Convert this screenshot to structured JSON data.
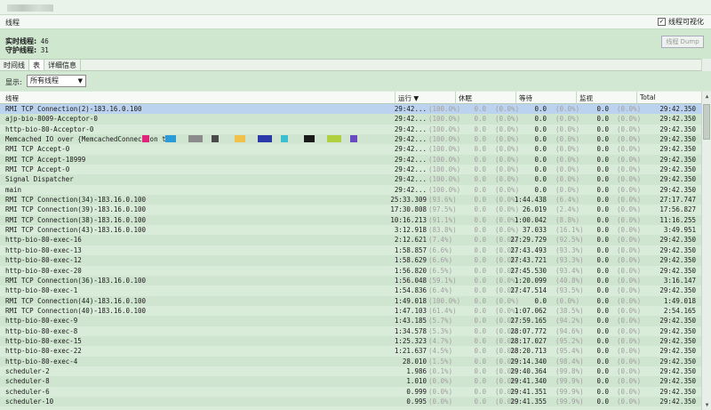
{
  "window": {
    "title": "线程",
    "visualize_label": "线程可视化",
    "visualize_checked": "✓"
  },
  "summary": {
    "live_label": "实时线程:",
    "live_value": "46",
    "daemon_label": "守护线程:",
    "daemon_value": "31",
    "dump_label": "线程 Dump"
  },
  "tabs": [
    {
      "label": "时间线"
    },
    {
      "label": "表"
    },
    {
      "label": "详细信息"
    }
  ],
  "filter": {
    "label": "显示:",
    "value": "所有线程"
  },
  "columns": {
    "thread": "线程",
    "running": "运行",
    "sleeping": "休眠",
    "wait": "等待",
    "monitor": "监视",
    "total": "Total"
  },
  "rows": [
    {
      "name": "RMI TCP Connection(2)-183.16.0.100",
      "run": "29:42...",
      "runp": "(100.0%)",
      "sleep": "0.0",
      "sleepp": "(0.0%)",
      "wait": "0.0",
      "waitp": "(0.0%)",
      "mon": "0.0",
      "monp": "(0.0%)",
      "total": "29:42.350"
    },
    {
      "name": "ajp-bio-8009-Acceptor-0",
      "run": "29:42...",
      "runp": "(100.0%)",
      "sleep": "0.0",
      "sleepp": "(0.0%)",
      "wait": "0.0",
      "waitp": "(0.0%)",
      "mon": "0.0",
      "monp": "(0.0%)",
      "total": "29:42.350"
    },
    {
      "name": "http-bio-80-Acceptor-0",
      "run": "29:42...",
      "runp": "(100.0%)",
      "sleep": "0.0",
      "sleepp": "(0.0%)",
      "wait": "0.0",
      "waitp": "(0.0%)",
      "mon": "0.0",
      "monp": "(0.0%)",
      "total": "29:42.350"
    },
    {
      "name": "Memcached IO over {MemcachedConnection to ",
      "run": "29:42...",
      "runp": "(100.0%)",
      "sleep": "0.0",
      "sleepp": "(0.0%)",
      "wait": "0.0",
      "waitp": "(0.0%)",
      "mon": "0.0",
      "monp": "(0.0%)",
      "total": "29:42.350"
    },
    {
      "name": "RMI TCP Accept-0",
      "run": "29:42...",
      "runp": "(100.0%)",
      "sleep": "0.0",
      "sleepp": "(0.0%)",
      "wait": "0.0",
      "waitp": "(0.0%)",
      "mon": "0.0",
      "monp": "(0.0%)",
      "total": "29:42.350"
    },
    {
      "name": "RMI TCP Accept-18999",
      "run": "29:42...",
      "runp": "(100.0%)",
      "sleep": "0.0",
      "sleepp": "(0.0%)",
      "wait": "0.0",
      "waitp": "(0.0%)",
      "mon": "0.0",
      "monp": "(0.0%)",
      "total": "29:42.350"
    },
    {
      "name": "RMI TCP Accept-0",
      "run": "29:42...",
      "runp": "(100.0%)",
      "sleep": "0.0",
      "sleepp": "(0.0%)",
      "wait": "0.0",
      "waitp": "(0.0%)",
      "mon": "0.0",
      "monp": "(0.0%)",
      "total": "29:42.350"
    },
    {
      "name": "Signal Dispatcher",
      "run": "29:42...",
      "runp": "(100.0%)",
      "sleep": "0.0",
      "sleepp": "(0.0%)",
      "wait": "0.0",
      "waitp": "(0.0%)",
      "mon": "0.0",
      "monp": "(0.0%)",
      "total": "29:42.350"
    },
    {
      "name": "main",
      "run": "29:42...",
      "runp": "(100.0%)",
      "sleep": "0.0",
      "sleepp": "(0.0%)",
      "wait": "0.0",
      "waitp": "(0.0%)",
      "mon": "0.0",
      "monp": "(0.0%)",
      "total": "29:42.350"
    },
    {
      "name": "RMI TCP Connection(34)-183.16.0.100",
      "run": "25:33.309",
      "runp": "(93.6%)",
      "sleep": "0.0",
      "sleepp": "(0.0%)",
      "wait": "1:44.438",
      "waitp": "(6.4%)",
      "mon": "0.0",
      "monp": "(0.0%)",
      "total": "27:17.747"
    },
    {
      "name": "RMI TCP Connection(39)-183.16.0.100",
      "run": "17:30.808",
      "runp": "(97.5%)",
      "sleep": "0.0",
      "sleepp": "(0.0%)",
      "wait": "26.019",
      "waitp": "(2.4%)",
      "mon": "0.0",
      "monp": "(0.0%)",
      "total": "17:56.827"
    },
    {
      "name": "RMI TCP Connection(38)-183.16.0.100",
      "run": "10:16.213",
      "runp": "(91.1%)",
      "sleep": "0.0",
      "sleepp": "(0.0%)",
      "wait": "1:00.042",
      "waitp": "(8.8%)",
      "mon": "0.0",
      "monp": "(0.0%)",
      "total": "11:16.255"
    },
    {
      "name": "RMI TCP Connection(43)-183.16.0.100",
      "run": "3:12.918",
      "runp": "(83.8%)",
      "sleep": "0.0",
      "sleepp": "(0.0%)",
      "wait": "37.033",
      "waitp": "(16.1%)",
      "mon": "0.0",
      "monp": "(0.0%)",
      "total": "3:49.951"
    },
    {
      "name": "http-bio-80-exec-16",
      "run": "2:12.621",
      "runp": "(7.4%)",
      "sleep": "0.0",
      "sleepp": "(0.0%)",
      "wait": "27:29.729",
      "waitp": "(92.5%)",
      "mon": "0.0",
      "monp": "(0.0%)",
      "total": "29:42.350"
    },
    {
      "name": "http-bio-80-exec-13",
      "run": "1:58.857",
      "runp": "(6.6%)",
      "sleep": "0.0",
      "sleepp": "(0.0%)",
      "wait": "27:43.493",
      "waitp": "(93.3%)",
      "mon": "0.0",
      "monp": "(0.0%)",
      "total": "29:42.350"
    },
    {
      "name": "http-bio-80-exec-12",
      "run": "1:58.629",
      "runp": "(6.6%)",
      "sleep": "0.0",
      "sleepp": "(0.0%)",
      "wait": "27:43.721",
      "waitp": "(93.3%)",
      "mon": "0.0",
      "monp": "(0.0%)",
      "total": "29:42.350"
    },
    {
      "name": "http-bio-80-exec-20",
      "run": "1:56.820",
      "runp": "(6.5%)",
      "sleep": "0.0",
      "sleepp": "(0.0%)",
      "wait": "27:45.530",
      "waitp": "(93.4%)",
      "mon": "0.0",
      "monp": "(0.0%)",
      "total": "29:42.350"
    },
    {
      "name": "RMI TCP Connection(36)-183.16.0.100",
      "run": "1:56.048",
      "runp": "(59.1%)",
      "sleep": "0.0",
      "sleepp": "(0.0%)",
      "wait": "1:20.099",
      "waitp": "(40.8%)",
      "mon": "0.0",
      "monp": "(0.0%)",
      "total": "3:16.147"
    },
    {
      "name": "http-bio-80-exec-1",
      "run": "1:54.836",
      "runp": "(6.4%)",
      "sleep": "0.0",
      "sleepp": "(0.0%)",
      "wait": "27:47.514",
      "waitp": "(93.5%)",
      "mon": "0.0",
      "monp": "(0.0%)",
      "total": "29:42.350"
    },
    {
      "name": "RMI TCP Connection(44)-183.16.0.100",
      "run": "1:49.018",
      "runp": "(100.0%)",
      "sleep": "0.0",
      "sleepp": "(0.0%)",
      "wait": "0.0",
      "waitp": "(0.0%)",
      "mon": "0.0",
      "monp": "(0.0%)",
      "total": "1:49.018"
    },
    {
      "name": "RMI TCP Connection(40)-183.16.0.100",
      "run": "1:47.103",
      "runp": "(61.4%)",
      "sleep": "0.0",
      "sleepp": "(0.0%)",
      "wait": "1:07.062",
      "waitp": "(38.5%)",
      "mon": "0.0",
      "monp": "(0.0%)",
      "total": "2:54.165"
    },
    {
      "name": "http-bio-80-exec-9",
      "run": "1:43.185",
      "runp": "(5.7%)",
      "sleep": "0.0",
      "sleepp": "(0.0%)",
      "wait": "27:59.165",
      "waitp": "(94.2%)",
      "mon": "0.0",
      "monp": "(0.0%)",
      "total": "29:42.350"
    },
    {
      "name": "http-bio-80-exec-8",
      "run": "1:34.578",
      "runp": "(5.3%)",
      "sleep": "0.0",
      "sleepp": "(0.0%)",
      "wait": "28:07.772",
      "waitp": "(94.6%)",
      "mon": "0.0",
      "monp": "(0.0%)",
      "total": "29:42.350"
    },
    {
      "name": "http-bio-80-exec-15",
      "run": "1:25.323",
      "runp": "(4.7%)",
      "sleep": "0.0",
      "sleepp": "(0.0%)",
      "wait": "28:17.027",
      "waitp": "(95.2%)",
      "mon": "0.0",
      "monp": "(0.0%)",
      "total": "29:42.350"
    },
    {
      "name": "http-bio-80-exec-22",
      "run": "1:21.637",
      "runp": "(4.5%)",
      "sleep": "0.0",
      "sleepp": "(0.0%)",
      "wait": "28:20.713",
      "waitp": "(95.4%)",
      "mon": "0.0",
      "monp": "(0.0%)",
      "total": "29:42.350"
    },
    {
      "name": "http-bio-80-exec-4",
      "run": "28.010",
      "runp": "(1.5%)",
      "sleep": "0.0",
      "sleepp": "(0.0%)",
      "wait": "29:14.340",
      "waitp": "(98.4%)",
      "mon": "0.0",
      "monp": "(0.0%)",
      "total": "29:42.350"
    },
    {
      "name": "scheduler-2",
      "run": "1.986",
      "runp": "(0.1%)",
      "sleep": "0.0",
      "sleepp": "(0.0%)",
      "wait": "29:40.364",
      "waitp": "(99.8%)",
      "mon": "0.0",
      "monp": "(0.0%)",
      "total": "29:42.350"
    },
    {
      "name": "scheduler-8",
      "run": "1.010",
      "runp": "(0.0%)",
      "sleep": "0.0",
      "sleepp": "(0.0%)",
      "wait": "29:41.340",
      "waitp": "(99.9%)",
      "mon": "0.0",
      "monp": "(0.0%)",
      "total": "29:42.350"
    },
    {
      "name": "scheduler-6",
      "run": "0.999",
      "runp": "(0.0%)",
      "sleep": "0.0",
      "sleepp": "(0.0%)",
      "wait": "29:41.351",
      "waitp": "(99.9%)",
      "mon": "0.0",
      "monp": "(0.0%)",
      "total": "29:42.350"
    },
    {
      "name": "scheduler-10",
      "run": "0.995",
      "runp": "(0.0%)",
      "sleep": "0.0",
      "sleepp": "(0.0%)",
      "wait": "29:41.355",
      "waitp": "(99.9%)",
      "mon": "0.0",
      "monp": "(0.0%)",
      "total": "29:42.350"
    }
  ],
  "icons": {
    "sort_desc": "sort-desc-icon",
    "dropdown": "chevron-down-icon",
    "scroll_up": "scroll-up-icon",
    "scroll_down": "scroll-down-icon"
  },
  "colors": {
    "background": "#d9ecd9",
    "selected_row": "#bcd3ef",
    "alt_row": "#cfe5cf"
  }
}
